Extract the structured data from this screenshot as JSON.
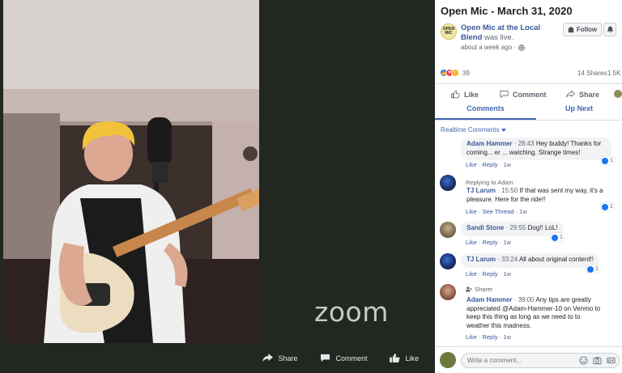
{
  "video": {
    "watermark": "zoom",
    "controls": {
      "share": "Share",
      "comment": "Comment",
      "like": "Like"
    }
  },
  "post": {
    "title": "Open Mic - March 31, 2020",
    "page_name": "Open Mic at the Local Blend",
    "status_text": " was live.",
    "time_ago": "about a week ago ·",
    "follow_label": "Follow",
    "logo_text": "OPEN MIC",
    "reaction_count": "39",
    "shares": "14 Shares",
    "views": "1.5K V"
  },
  "actions": {
    "like": "Like",
    "comment": "Comment",
    "share": "Share"
  },
  "tabs": {
    "comments": "Comments",
    "up_next": "Up Next"
  },
  "realtime_label": "Realtime Comments",
  "comments": [
    {
      "author": "Adam Hammer",
      "time": " · 28:43 ",
      "text_a": "Hey buddy! Thanks for",
      "text_b": "coming... er ... watching. Strange times!",
      "like": "Like",
      "reply": "Reply",
      "ago": "1w",
      "likes": "1"
    },
    {
      "reply_to": "Replying to Adam",
      "author": "TJ Larum",
      "time": " · 15:50 ",
      "text_a": "If that was sent my way, it's a",
      "text_b": "pleasure. Here for the ride!!",
      "like": "Like",
      "reply": "See Thread",
      "ago": "1w",
      "likes": "1"
    },
    {
      "author": "Sandi Stone",
      "time": " · 29:55 ",
      "text_a": "Dog!! LoL!",
      "like": "Like",
      "reply": "Reply",
      "ago": "1w",
      "likes": "1"
    },
    {
      "author": "TJ Larum",
      "time": " · 33:24 ",
      "text_a": "All about original content!!",
      "like": "Like",
      "reply": "Reply",
      "ago": "1w",
      "likes": "1"
    },
    {
      "badge": "Sharer",
      "author": "Adam Hammer",
      "time": " · 39:00 ",
      "text_a": "Any tips are greatly",
      "text_b": "appreciated @Adam-Hammer-10 on Venmo to",
      "text_c": "keep this thing as long as we need to to",
      "text_d": "weather this madness.",
      "like": "Like",
      "reply": "Reply",
      "ago": "1w"
    }
  ],
  "composer": {
    "placeholder": "Write a comment..."
  },
  "colors": {
    "facebook_blue": "#4267b2",
    "link_blue": "#385898",
    "bubble_gray": "#f2f3f5"
  }
}
